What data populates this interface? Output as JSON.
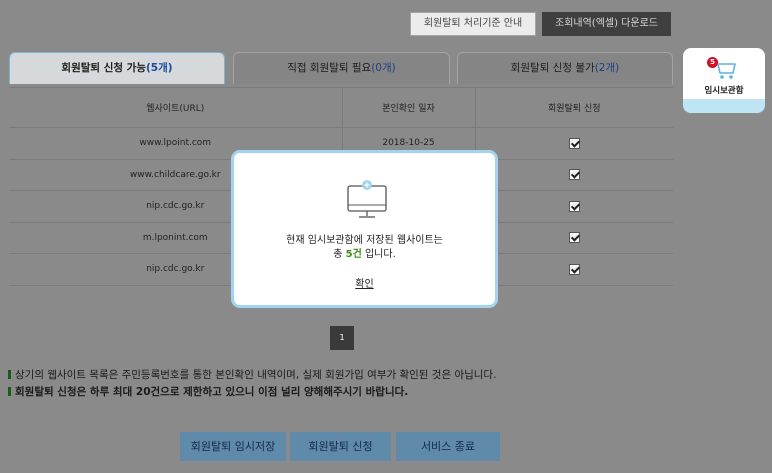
{
  "top_buttons": {
    "guide_label": "회원탈퇴 처리기준 안내",
    "download_label": "조회내역(엑셀) 다운로드"
  },
  "tabs": [
    {
      "label": "회원탈퇴 신청 가능",
      "count": "(5개)"
    },
    {
      "label": "직접 회원탈퇴 필요",
      "count": "(0개)"
    },
    {
      "label": "회원탈퇴 신청 불가",
      "count": "(2개)"
    }
  ],
  "table": {
    "headers": [
      "웹사이트(URL)",
      "본인확인 일자",
      "회원탈퇴 신청"
    ],
    "rows": [
      {
        "url": "www.lpoint.com",
        "date": "2018-10-25"
      },
      {
        "url": "www.childcare.go.kr",
        "date": ""
      },
      {
        "url": "nip.cdc.go.kr",
        "date": ""
      },
      {
        "url": "m.lponint.com",
        "date": ""
      },
      {
        "url": "nip.cdc.go.kr",
        "date": ""
      }
    ]
  },
  "temp_storage": {
    "badge_count": "5",
    "label": "임시보관함"
  },
  "pagination": {
    "current_page": "1"
  },
  "notes": [
    "상기의 웹사이트 목록은 주민등록번호를 통한 본인확인 내역이며, 실제 회원가입 여부가 확인된 것은 아닙니다.",
    "회원탈퇴 신청은 하루 최대 20건으로 제한하고 있으니 이점 널리 양해해주시기 바랍니다."
  ],
  "bottom_buttons": {
    "temp_save": "회원탈퇴 임시저장",
    "apply": "회원탈퇴 신청",
    "exit": "서비스 종료"
  },
  "modal": {
    "line1": "현재 임시보관함에 저장된 웹사이트는",
    "line2_prefix": "총 ",
    "count": "5건",
    "line2_suffix": " 입니다.",
    "ok_label": "확인"
  },
  "colors": {
    "overlay": "#8a8a8a",
    "modal_border": "#a3d3ee",
    "highlight_green": "#3e8f16",
    "badge_red": "#d0112b"
  }
}
